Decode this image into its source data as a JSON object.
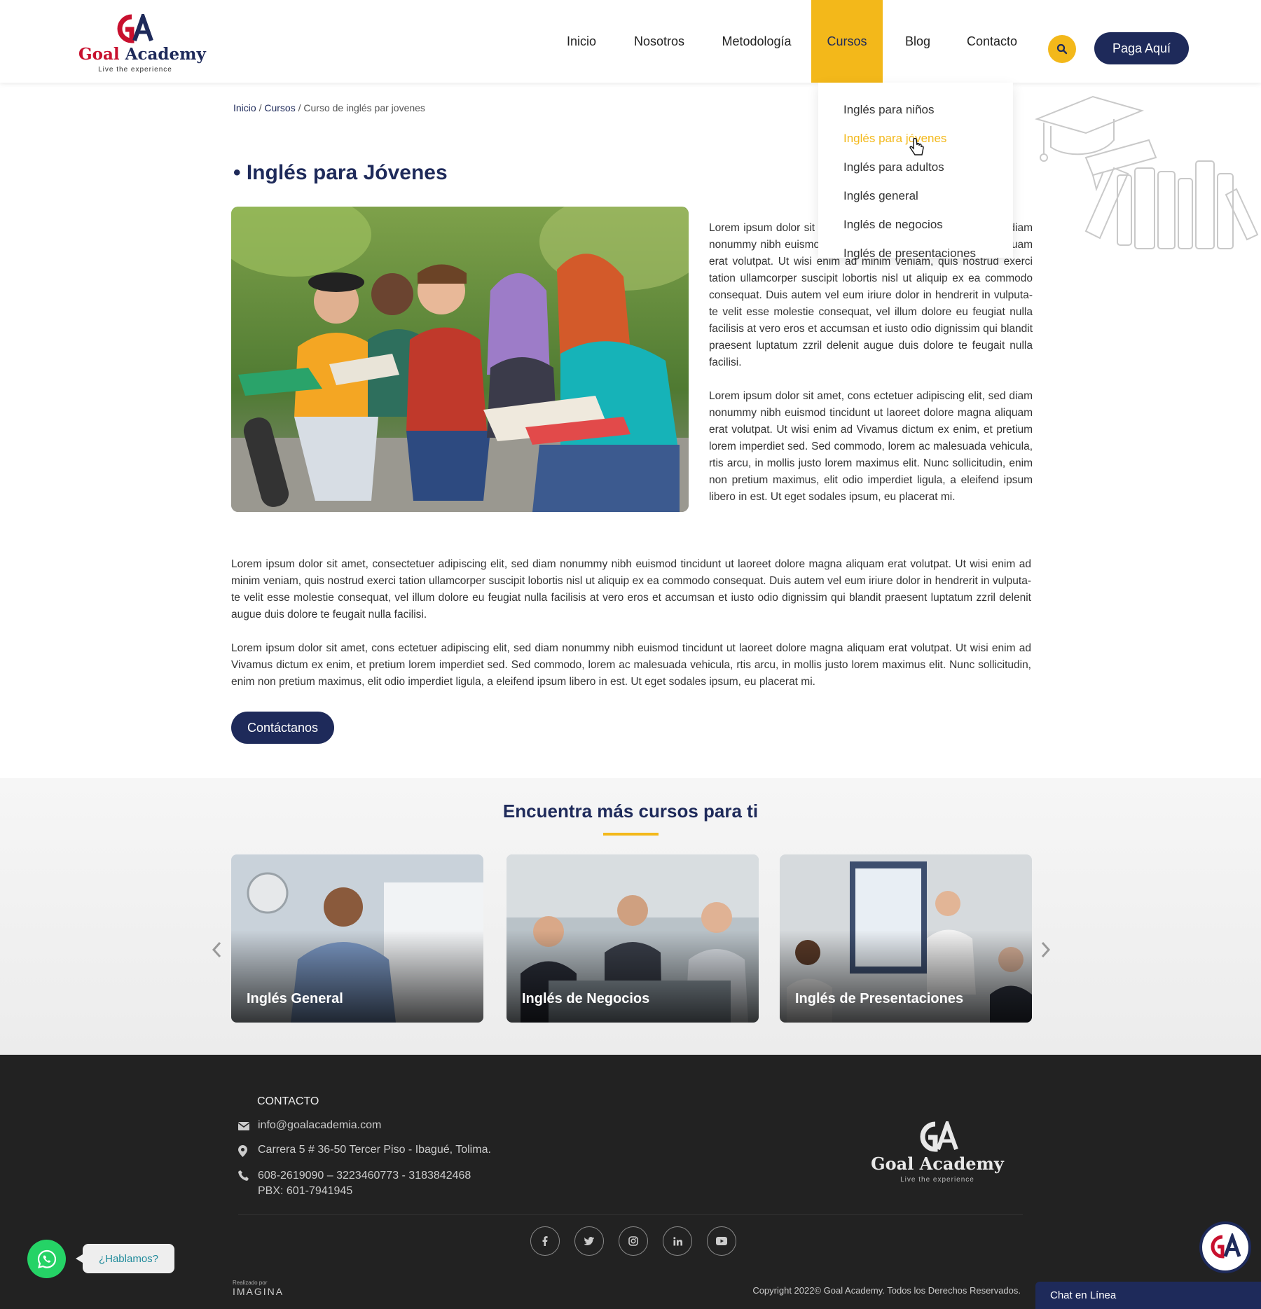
{
  "header": {
    "logo": {
      "name_part1": "Goal",
      "name_part2": "Academy",
      "tagline": "Live the experience"
    },
    "nav": [
      {
        "label": "Inicio"
      },
      {
        "label": "Nosotros"
      },
      {
        "label": "Metodología"
      },
      {
        "label": "Cursos",
        "active": true
      },
      {
        "label": "Blog"
      },
      {
        "label": "Contacto"
      }
    ],
    "search_icon": "search-icon",
    "pay_button": "Paga Aquí"
  },
  "dropdown": {
    "items": [
      {
        "label": "Inglés para niños"
      },
      {
        "label": "Inglés para jóvenes",
        "active": true
      },
      {
        "label": "Inglés para adultos"
      },
      {
        "label": "Inglés general"
      },
      {
        "label": "Inglés de negocios"
      },
      {
        "label": "Inglés de presentaciones"
      }
    ]
  },
  "breadcrumb": {
    "items": [
      "Inicio",
      "Cursos",
      "Curso de inglés par jovenes"
    ],
    "separator": "/"
  },
  "main": {
    "title": "• Inglés para Jóvenes",
    "side_paragraphs": [
      "Lorem ipsum dolor sit amet, consectetuer adipiscing elit, sed diam nonummy nibh euismod tincidunt ut laoreet dolore magna aliquam erat volutpat. Ut wisi enim ad minim veniam, quis nostrud exerci tation ullamcorper suscipit lobortis nisl ut aliquip ex ea commodo consequat. Duis autem vel eum iriure dolor in hendrerit in vulputa-te velit esse molestie consequat, vel illum dolore eu feugiat nulla facilisis at vero eros et accumsan et iusto odio dignissim qui blandit praesent luptatum zzril delenit augue duis dolore te feugait nulla facilisi.",
      "Lorem ipsum dolor sit amet, cons ectetuer adipiscing elit, sed diam nonummy nibh euismod tincidunt ut laoreet dolore magna aliquam erat volutpat. Ut wisi enim ad  Vivamus dictum ex enim, et pretium lorem imperdiet sed. Sed commodo, lorem ac malesuada vehicula, rtis arcu, in mollis justo lorem maximus elit. Nunc sollicitudin, enim non pretium maximus, elit odio imperdiet ligula, a eleifend ipsum libero in est. Ut eget sodales ipsum, eu placerat mi."
    ],
    "full_paragraphs": [
      "Lorem ipsum dolor sit amet, consectetuer adipiscing elit, sed diam nonummy nibh euismod tincidunt ut laoreet dolore magna aliquam erat volutpat. Ut wisi enim ad minim veniam, quis nostrud exerci tation ullamcorper suscipit lobortis nisl ut aliquip ex ea commodo consequat. Duis autem vel eum iriure dolor in hendrerit in vulputa-te velit esse molestie consequat, vel illum dolore eu feugiat nulla facilisis at vero eros et accumsan et iusto odio dignissim qui blandit praesent luptatum zzril delenit augue duis dolore te feugait nulla facilisi.",
      "Lorem ipsum dolor sit amet, cons ectetuer adipiscing elit, sed diam nonummy nibh euismod tincidunt ut laoreet dolore magna aliquam erat volutpat. Ut wisi enim ad Vivamus dictum ex enim, et pretium lorem imperdiet sed. Sed commodo, lorem ac malesuada vehicula, rtis arcu, in mollis justo lorem maximus elit. Nunc sollicitudin, enim non pretium maximus, elit odio imperdiet ligula, a eleifend ipsum libero in est. Ut eget sodales ipsum, eu placerat mi."
    ],
    "contact_button": "Contáctanos"
  },
  "more_courses": {
    "title": "Encuentra más cursos para ti",
    "cards": [
      {
        "label": "Inglés General"
      },
      {
        "label": "Inglés de Negocios"
      },
      {
        "label": "Inglés de Presentaciones"
      }
    ]
  },
  "footer": {
    "heading": "CONTACTO",
    "email": "info@goalacademia.com",
    "address": "Carrera 5 # 36-50 Tercer Piso - Ibagué, Tolima.",
    "phones": "608-2619090 – 3223460773 - 3183842468",
    "pbx": "PBX: 601-7941945",
    "logo": {
      "name": "Goal Academy",
      "tagline": "Live the experience"
    },
    "social": [
      "f",
      "t",
      "ig",
      "in",
      "yt"
    ],
    "credit_small": "Realizado por",
    "credit_big": "IMAGINA",
    "copyright": "Copyright 2022© Goal Academy. Todos los Derechos Reservados."
  },
  "floating": {
    "whatsapp_bubble": "¿Hablamos?",
    "chat_bar": "Chat en Línea"
  },
  "colors": {
    "navy": "#1e2a5a",
    "yellow": "#f3b81a",
    "red": "#c8102e",
    "footer_bg": "#222222",
    "whatsapp": "#25d366"
  }
}
